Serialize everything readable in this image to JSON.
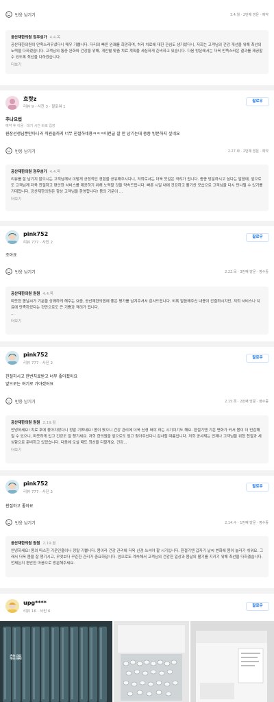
{
  "review0": {
    "reaction_label": "반응 남기기",
    "visit_info": "3.4.월 · 2번째 방문 · 예약",
    "reply": {
      "name": "공산재한의원 정우성가",
      "date": "4.4.목",
      "text": "공산재한의원이 만족스러우셨다니 매우 기쁩니다. 다리의 빠른 완쾌를 희망하며, 허리 치료에 대한 관심도 생기셨다니, 저희는 고객님의 건강 개선을 위해 최선의 노력을 다하겠습니다. 고객님의 통증 완화와 건강을 위해, 개인별 맞춤 치료 계획을 세심하게 준비하고 있습니다. 다음 방문에서는 더욱 만족스러운 결과를 제공할 수 있도록 최선을 다하겠습니다.",
      "more": "더보기"
    }
  },
  "review1": {
    "nickname": "흐핫z",
    "meta": "리뷰 9 · 사진 3 · 팔로워 1",
    "follow": "팔로우",
    "tag_title": "추나요법",
    "tag_line": "예약 후 이용 · 대기 시간 바로 입장",
    "text": "원장선생님뿐만아니라 직원들까지 너무 친절하네용ㅋㅋㅋ이런글 잘 안 남기는데 종종 방문하지 싶네요",
    "reaction_label": "반응 남기기",
    "visit_info": "2.27.화 · 2번째 방문 · 예약",
    "reply": {
      "name": "공산재한의원 정우성가",
      "date": "4.4.목",
      "text": "리뷰를 잘 남기지 않으시는 고객님께서 이렇게 긍정적인 경험을 공유해주시다니, 저희로서는 더욱 뜻깊은 격려가 됩니다. 종종 방문하시고 싶다는 말씀에, 앞으로도 고객님께 더욱 친절하고 편안한 서비스를 제공하기 위해 노력할 것을 약속드립니다. 빠른 시일 내에 건강하고 활기찬 모습으로 고객님을 다시 만나뵐 수 있기를 기대합니다. 공산재한의원은 항상 고객님을 환영합니다! 봄의 기운이 ...",
      "more": "더보기"
    }
  },
  "review2": {
    "nickname": "pink752",
    "meta": "리뷰 777 · 사진 2",
    "follow": "팔로우",
    "text": "조아요",
    "reaction_label": "반응 남기기",
    "visit_info": "2.22.목 · 3번째 방문 · 영수증",
    "reply": {
      "name": "공산재한의원 원원",
      "date": "4.4.목",
      "text": "따뜻한 봄날씨가 기분을 상쾌하게 해주는 요즘, 공산재한의원에 좋은 평가를 남겨주셔서 감사드립니다. 비록 말씀해주신 내용이 간결하시지만, 저희 서비스나 치료에 만족하셨다는 것만으로도 큰 기쁨과 격려가 됩니다.\n...",
      "more": "더보기"
    }
  },
  "review3": {
    "nickname": "pink752",
    "meta": "리뷰 777 · 사진 2",
    "follow": "팔로우",
    "text_line1": "친절하시고 한번치료받고 너무 좋아졌어요",
    "text_line2": "앞으로는 여기로 가야겠어요",
    "reaction_label": "반응 남기기",
    "visit_info": "2.15.목 · 2번째 방문 · 영수증",
    "reply": {
      "name": "공산재한의원 원원",
      "date": "2.19.월",
      "text": "안녕하세요! 치료 후에 좋아지셨다니 정말 기쁘네요! 봄이 왔으니 건강 관리에 더욱 신경 써야 하는 시기이기도 해요. 환절기엔 기온 변화가 커서 몸이 더 민감해질 수 있으니, 따뜻하게 입고 건강도 잘 챙기세요. 저희 한의원을 앞으로도 믿고 찾아주신다니 감사할 따름입니다. 저희 공사재는 언제나 고객님을 위한 친절과 세심함으로 준비하고 있겠습니다. 다음에 오실 때도 최선을 다할게요. 건강...",
      "more": "더보기"
    }
  },
  "review4": {
    "nickname": "pink752",
    "meta": "리뷰 777 · 사진 2",
    "follow": "팔로우",
    "text": "친절하고 좋아요",
    "reaction_label": "반응 남기기",
    "visit_info": "2.14.수 · 1번째 방문 · 영수증",
    "reply": {
      "name": "공산재한의원 원원",
      "date": "2.19.월",
      "text": "안녕하세요! 봄의 따스한 기운인줄이나 정말 기쁩니다. 봄이라 건강 관리에 더욱 신경 쓰셔야 할 시기입니다. 환절기엔 갑자기 날씨 변화에 몸이 놀라기 쉬워요. 그래서 더욱 몸을 잘 챙기시고, 무엇보다 꾸준한 관리가 중요하답니다. 앞으로도 계속해서 고객님의 건강한 일상과 봄날의 활기를 지키기 위해 최선을 다하겠습니다. 언제든지 편안한 마음으로 방문해주세요."
    }
  },
  "review5": {
    "nickname": "upg****",
    "meta": "리뷰 16 · 사진 6",
    "follow": "팔로우",
    "photo_label": "韓藥"
  },
  "colors": {
    "follow_blue": "#1a73e8",
    "divider": "#f2f2f2",
    "reply_bg": "#f6f6f6"
  },
  "icons": [
    "smile-icon",
    "avatar-icon",
    "photo-thumbnail"
  ]
}
